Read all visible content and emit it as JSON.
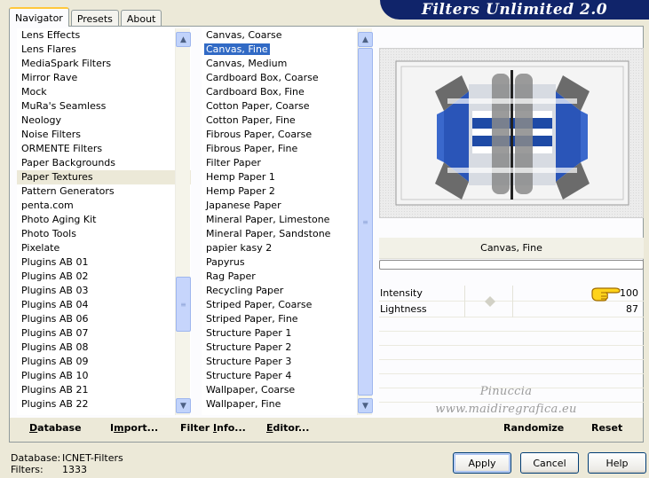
{
  "tabs": [
    "Navigator",
    "Presets",
    "About"
  ],
  "app_title": "Filters Unlimited 2.0",
  "categories": [
    "Lens Effects",
    "Lens Flares",
    "MediaSpark Filters",
    "Mirror Rave",
    "Mock",
    "MuRa's Seamless",
    "Neology",
    "Noise Filters",
    "ORMENTE Filters",
    "Paper Backgrounds",
    "Paper Textures",
    "Pattern Generators",
    "penta.com",
    "Photo Aging Kit",
    "Photo Tools",
    "Pixelate",
    "Plugins AB 01",
    "Plugins AB 02",
    "Plugins AB 03",
    "Plugins AB 04",
    "Plugins AB 06",
    "Plugins AB 07",
    "Plugins AB 08",
    "Plugins AB 09",
    "Plugins AB 10",
    "Plugins AB 21",
    "Plugins AB 22"
  ],
  "selected_category": "Paper Textures",
  "filters": [
    "Canvas, Coarse",
    "Canvas, Fine",
    "Canvas, Medium",
    "Cardboard Box, Coarse",
    "Cardboard Box, Fine",
    "Cotton Paper, Coarse",
    "Cotton Paper, Fine",
    "Fibrous Paper, Coarse",
    "Fibrous Paper, Fine",
    "Filter Paper",
    "Hemp Paper 1",
    "Hemp Paper 2",
    "Japanese Paper",
    "Mineral Paper, Limestone",
    "Mineral Paper, Sandstone",
    "papier kasy 2",
    "Papyrus",
    "Rag Paper",
    "Recycling Paper",
    "Striped Paper, Coarse",
    "Striped Paper, Fine",
    "Structure Paper 1",
    "Structure Paper 2",
    "Structure Paper 3",
    "Structure Paper 4",
    "Wallpaper, Coarse",
    "Wallpaper, Fine"
  ],
  "selected_filter": "Canvas, Fine",
  "current_filter_name": "Canvas, Fine",
  "parameters": [
    {
      "label": "Intensity",
      "value": "100"
    },
    {
      "label": "Lightness",
      "value": "87"
    }
  ],
  "watermark": {
    "line1": "Pinuccia",
    "line2": "www.maidiregrafica.eu"
  },
  "bottom_links": {
    "database": {
      "ul": "D",
      "rest": "atabase"
    },
    "import": {
      "pre": "I",
      "ul": "m",
      "rest": "port..."
    },
    "filter_info": {
      "pre": "Filter ",
      "ul": "I",
      "rest": "nfo..."
    },
    "editor": {
      "ul": "E",
      "rest": "ditor..."
    },
    "randomize": "Randomize",
    "reset": "Reset"
  },
  "status": {
    "database_label": "Database:",
    "database_value": "ICNET-Filters",
    "filters_label": "Filters:",
    "filters_value": "1333"
  },
  "buttons": {
    "apply": "Apply",
    "cancel": "Cancel",
    "help": "Help"
  },
  "colors": {
    "accent": "#316ac5",
    "banner": "#10246a",
    "tab_highlight": "#ffc83c"
  }
}
